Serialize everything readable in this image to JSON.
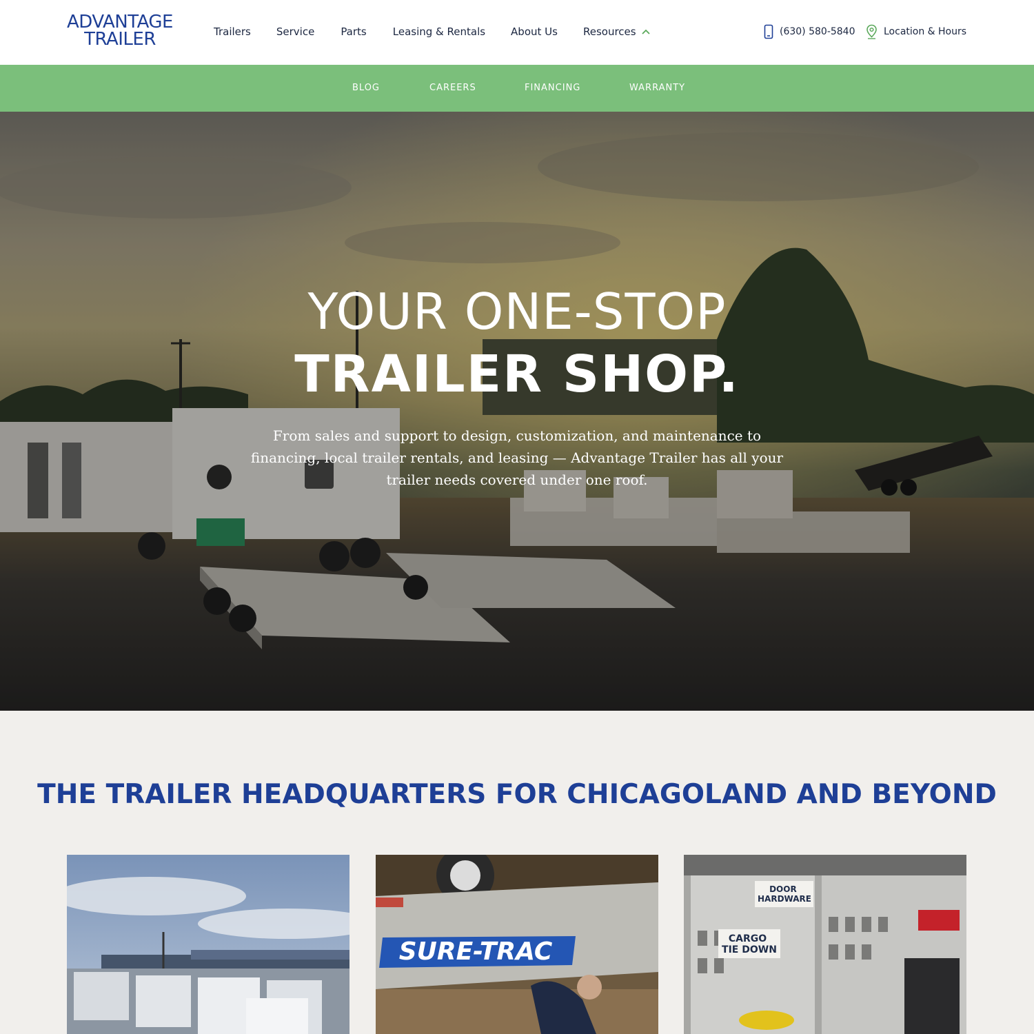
{
  "header": {
    "logo_line1": "ADVANTAGE",
    "logo_line2": "TRAILER",
    "nav": {
      "trailers": "Trailers",
      "service": "Service",
      "parts": "Parts",
      "leasing": "Leasing & Rentals",
      "about": "About Us",
      "resources": "Resources"
    },
    "phone": "(630) 580-5840",
    "location": "Location & Hours"
  },
  "subnav": {
    "blog": "BLOG",
    "careers": "CAREERS",
    "financing": "FINANCING",
    "warranty": "WARRANTY"
  },
  "hero": {
    "title_line1": "YOUR ONE-STOP",
    "title_line2": "TRAILER SHOP.",
    "subtitle": "From sales and support to design, customization, and maintenance to financing, local trailer rentals, and leasing — Advantage Trailer has all your trailer needs covered under one roof."
  },
  "section": {
    "title": "THE TRAILER HEADQUARTERS FOR CHICAGOLAND AND BEYOND"
  },
  "cards": {
    "card2_brand": "SURE-TRAC",
    "card3_sign1": "DOOR HARDWARE",
    "card3_sign2": "CARGO TIE DOWN"
  },
  "colors": {
    "brand_blue": "#1e3f96",
    "subnav_green": "#7bbf7b",
    "accent_green": "#5aa85a",
    "section_bg": "#f1efec"
  },
  "icons": {
    "phone": "phone-icon",
    "location": "location-pin-icon",
    "resources_chevron": "chevron-up-icon"
  }
}
